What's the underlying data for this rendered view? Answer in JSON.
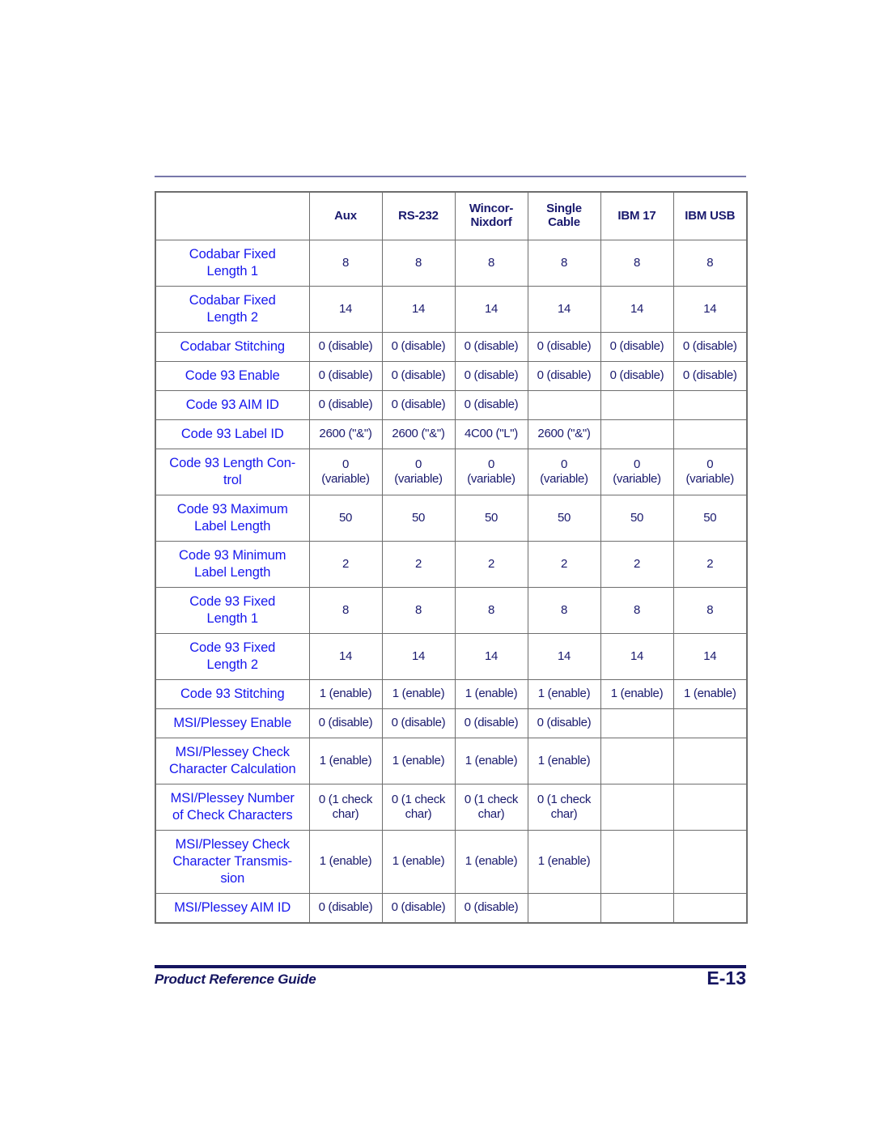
{
  "document": {
    "footer_title": "Product Reference Guide",
    "page_number": "E-13",
    "colors": {
      "param_blue": "#1717ee",
      "value_navy": "#1a1a6e",
      "footer_navy": "#151560",
      "top_rule": "#7777aa",
      "border_gray": "#6e6e6e"
    }
  },
  "table": {
    "columns": [
      {
        "label": ""
      },
      {
        "label": "Aux"
      },
      {
        "label": "RS-232"
      },
      {
        "label": "Wincor-\nNixdorf",
        "line1": "Wincor-",
        "line2": "Nixdorf"
      },
      {
        "label": "Single\nCable",
        "line1": "Single",
        "line2": "Cable"
      },
      {
        "label": "IBM 17"
      },
      {
        "label": "IBM USB"
      }
    ],
    "rows": [
      {
        "lines": 2,
        "param_line1": "Codabar Fixed",
        "param_line2": "Length 1",
        "values": [
          "8",
          "8",
          "8",
          "8",
          "8",
          "8"
        ]
      },
      {
        "lines": 2,
        "param_line1": "Codabar Fixed",
        "param_line2": "Length 2",
        "values": [
          "14",
          "14",
          "14",
          "14",
          "14",
          "14"
        ]
      },
      {
        "lines": 1,
        "param_line1": "Codabar Stitching",
        "values": [
          "0 (disable)",
          "0 (disable)",
          "0 (disable)",
          "0 (disable)",
          "0 (disable)",
          "0 (disable)"
        ]
      },
      {
        "lines": 1,
        "param_line1": "Code 93 Enable",
        "values": [
          "0 (disable)",
          "0 (disable)",
          "0 (disable)",
          "0 (disable)",
          "0 (disable)",
          "0 (disable)"
        ]
      },
      {
        "lines": 1,
        "param_line1": "Code 93 AIM ID",
        "values": [
          "0 (disable)",
          "0 (disable)",
          "0 (disable)",
          "",
          "",
          ""
        ]
      },
      {
        "lines": 1,
        "param_line1": "Code 93 Label ID",
        "values": [
          "2600 (\"&\")",
          "2600 (\"&\")",
          "4C00 (\"L\")",
          "2600 (\"&\")",
          "",
          ""
        ]
      },
      {
        "lines": 2,
        "param_line1": "Code 93 Length Con-",
        "param_line2": "trol",
        "values": [
          "0\n(variable)",
          "0\n(variable)",
          "0\n(variable)",
          "0\n(variable)",
          "0\n(variable)",
          "0\n(variable)"
        ],
        "value_line1": "0",
        "value_line2": "(variable)"
      },
      {
        "lines": 2,
        "param_line1": "Code 93 Maximum",
        "param_line2": "Label Length",
        "values": [
          "50",
          "50",
          "50",
          "50",
          "50",
          "50"
        ]
      },
      {
        "lines": 2,
        "param_line1": "Code 93 Minimum",
        "param_line2": "Label Length",
        "values": [
          "2",
          "2",
          "2",
          "2",
          "2",
          "2"
        ]
      },
      {
        "lines": 2,
        "param_line1": "Code 93 Fixed",
        "param_line2": "Length 1",
        "values": [
          "8",
          "8",
          "8",
          "8",
          "8",
          "8"
        ]
      },
      {
        "lines": 2,
        "param_line1": "Code 93 Fixed",
        "param_line2": "Length 2",
        "values": [
          "14",
          "14",
          "14",
          "14",
          "14",
          "14"
        ]
      },
      {
        "lines": 1,
        "param_line1": "Code 93 Stitching",
        "values": [
          "1 (enable)",
          "1 (enable)",
          "1 (enable)",
          "1 (enable)",
          "1 (enable)",
          "1 (enable)"
        ]
      },
      {
        "lines": 1,
        "param_line1": "MSI/Plessey Enable",
        "values": [
          "0 (disable)",
          "0 (disable)",
          "0 (disable)",
          "0 (disable)",
          "",
          ""
        ]
      },
      {
        "lines": 2,
        "param_line1": "MSI/Plessey Check",
        "param_line2": "Character Calculation",
        "values": [
          "1 (enable)",
          "1 (enable)",
          "1 (enable)",
          "1 (enable)",
          "",
          ""
        ]
      },
      {
        "lines": 2,
        "param_line1": "MSI/Plessey Number",
        "param_line2": "of Check Characters",
        "values": [
          "0 (1 check\nchar)",
          "0 (1 check\nchar)",
          "0 (1 check\nchar)",
          "0 (1 check\nchar)",
          "",
          ""
        ],
        "value_line1": "0 (1 check",
        "value_line2": "char)"
      },
      {
        "lines": 3,
        "param_line1": "MSI/Plessey Check",
        "param_line2": "Character Transmis-",
        "param_line3": "sion",
        "values": [
          "1 (enable)",
          "1 (enable)",
          "1 (enable)",
          "1 (enable)",
          "",
          ""
        ]
      },
      {
        "lines": 1,
        "param_line1": "MSI/Plessey AIM ID",
        "values": [
          "0 (disable)",
          "0 (disable)",
          "0 (disable)",
          "",
          "",
          ""
        ]
      }
    ]
  }
}
